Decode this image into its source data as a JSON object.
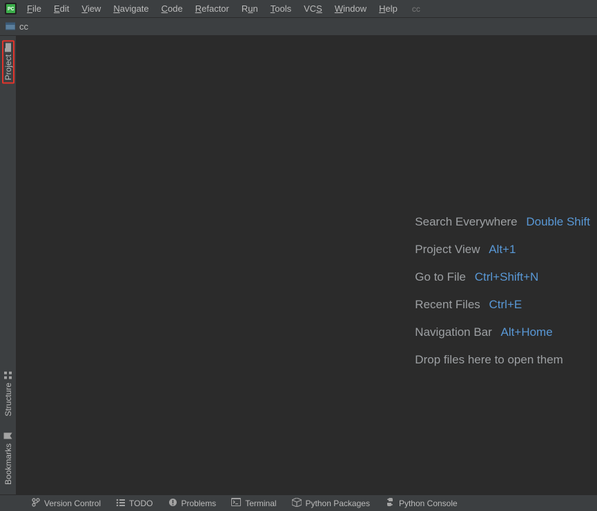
{
  "app": {
    "project_tag": "cc"
  },
  "menu": {
    "file": {
      "label": "File",
      "mn": "F"
    },
    "edit": {
      "label": "Edit",
      "mn": "E"
    },
    "view": {
      "label": "View",
      "mn": "V"
    },
    "navigate": {
      "label": "Navigate",
      "mn": "N"
    },
    "code": {
      "label": "Code",
      "mn": "C"
    },
    "refactor": {
      "label": "Refactor",
      "mn": "R"
    },
    "run": {
      "label": "Run",
      "mn": "u"
    },
    "tools": {
      "label": "Tools",
      "mn": "T"
    },
    "vcs": {
      "label": "VCS",
      "mn": "S"
    },
    "window": {
      "label": "Window",
      "mn": "W"
    },
    "help": {
      "label": "Help",
      "mn": "H"
    }
  },
  "breadcrumb": {
    "project": "cc"
  },
  "left_tools": {
    "project": "Project",
    "structure": "Structure",
    "bookmarks": "Bookmarks"
  },
  "tips": {
    "search": {
      "label": "Search Everywhere",
      "shortcut": "Double Shift"
    },
    "project": {
      "label": "Project View",
      "shortcut": "Alt+1"
    },
    "goto": {
      "label": "Go to File",
      "shortcut": "Ctrl+Shift+N"
    },
    "recent": {
      "label": "Recent Files",
      "shortcut": "Ctrl+E"
    },
    "navbar": {
      "label": "Navigation Bar",
      "shortcut": "Alt+Home"
    },
    "drop": "Drop files here to open them"
  },
  "status": {
    "vcs": "Version Control",
    "todo": "TODO",
    "problems": "Problems",
    "terminal": "Terminal",
    "pypkg": "Python Packages",
    "pyconsole": "Python Console"
  }
}
